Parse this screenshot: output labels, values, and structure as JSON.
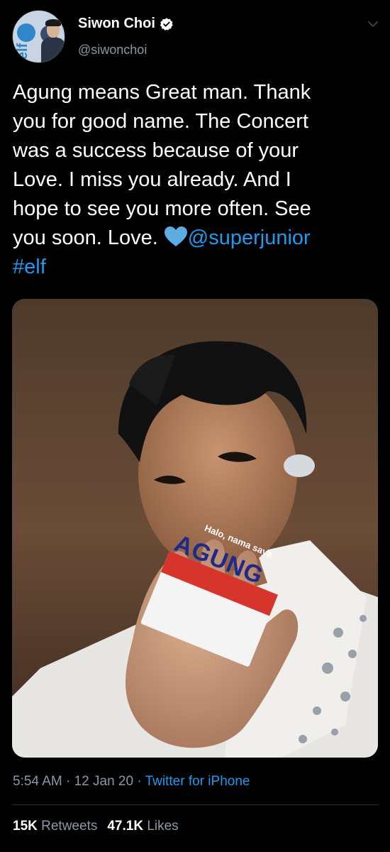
{
  "author": {
    "display_name": "Siwon Choi",
    "handle": "@siwonchoi",
    "verified": true
  },
  "tweet": {
    "text_lines": [
      "Agung means Great man. Thank",
      "you for good name. The Concert",
      "was a success because of your",
      "Love. I miss you already. And I",
      "hope to see you more often. See",
      "you soon. Love."
    ],
    "mention": "@superjunior",
    "hashtag": "#elf",
    "emoji": "blue-heart"
  },
  "media": {
    "sticker_top": "Halo, nama saya",
    "sticker_name": "AGUNG"
  },
  "meta": {
    "time": "5:54 AM",
    "sep1": " · ",
    "date": "12 Jan 20",
    "sep2": " · ",
    "source": "Twitter for iPhone"
  },
  "stats": {
    "retweets_count": "15K",
    "retweets_label": "Retweets",
    "likes_count": "47.1K",
    "likes_label": "Likes"
  },
  "colors": {
    "background": "#000000",
    "link": "#1d9bf0",
    "secondary_text": "#8b98a5"
  }
}
